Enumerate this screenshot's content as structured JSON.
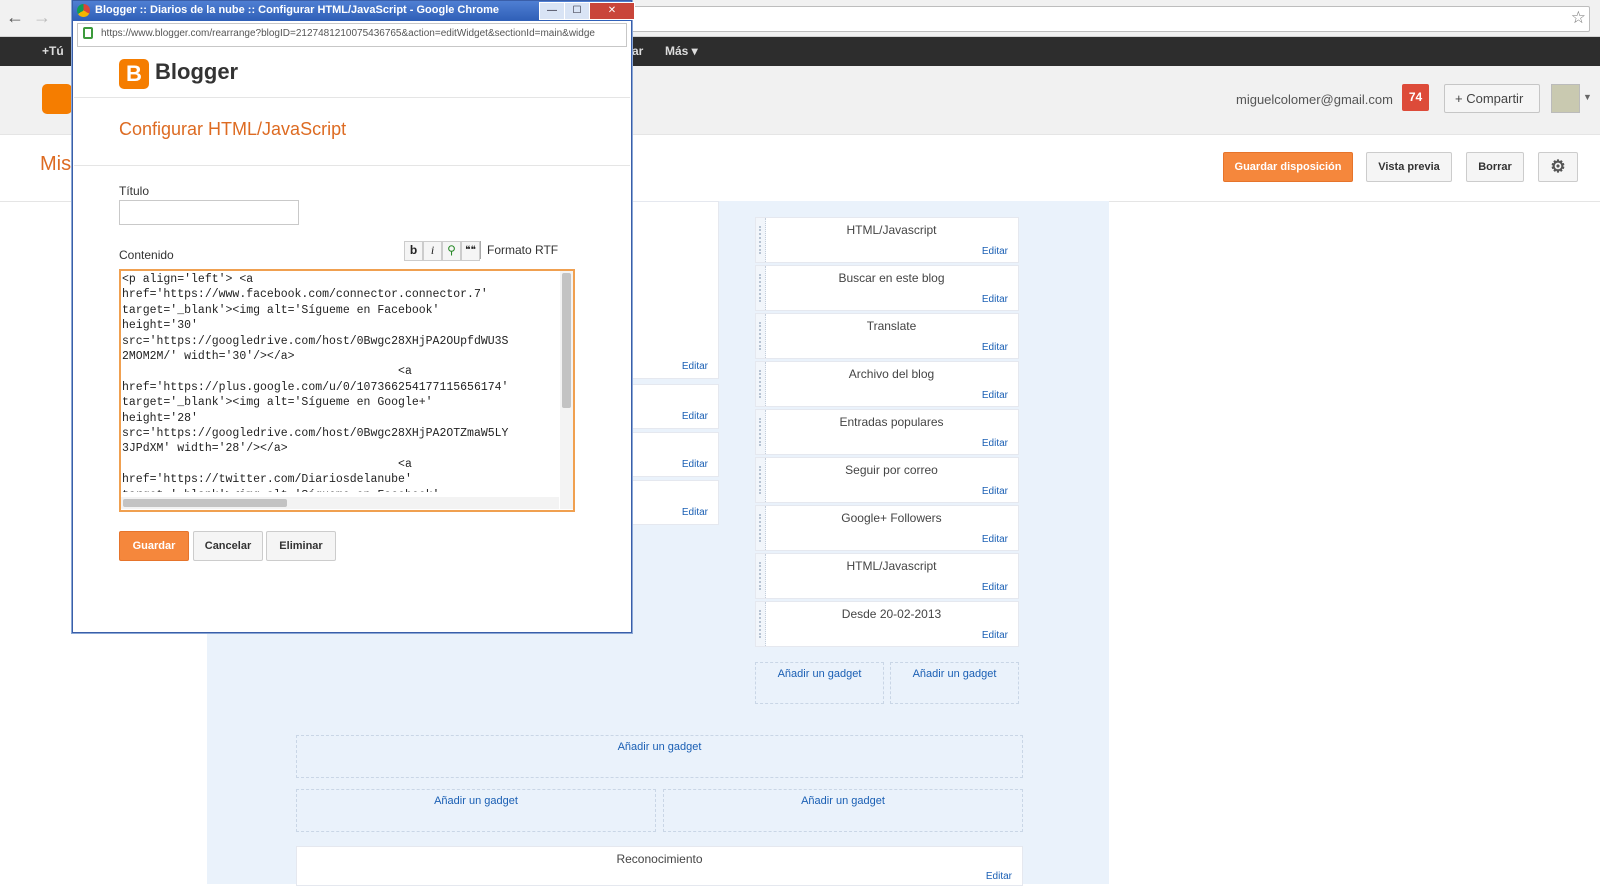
{
  "browser": {
    "popup_title": "Blogger :: Diarios de la nube :: Configurar HTML/JavaScript - Google Chrome",
    "popup_url": "https://www.blogger.com/rearrange?blogID=2127481210075436765&action=editWidget&sectionId=main&widge",
    "min": "—",
    "max": "☐",
    "close": "✕"
  },
  "gbar": {
    "tu": "+Tú",
    "ar": "ar",
    "mas": "Más ▾"
  },
  "header": {
    "email": "miguelcolomer@gmail.com",
    "notifications": "74",
    "share": "+  Compartir",
    "section_title": "Mis"
  },
  "toolbar": {
    "save_layout": "Guardar disposición",
    "preview": "Vista previa",
    "delete": "Borrar",
    "settings_icon": "⚙"
  },
  "dialog": {
    "brand": "Blogger",
    "brand_mark": "B",
    "heading": "Configurar HTML/JavaScript",
    "title_label": "Título",
    "title_value": "",
    "content_label": "Contenido",
    "fmt_bold": "b",
    "fmt_italic": "i",
    "fmt_quote": "❝❝",
    "rich_text": "Formato RTF",
    "save": "Guardar",
    "cancel": "Cancelar",
    "remove": "Eliminar",
    "code_lines": [
      "<p align='left'> <a",
      "href='https://www.facebook.com/connector.connector.7'",
      "target='_blank'><img alt='Sígueme en Facebook'",
      "height='30'",
      "src='https://googledrive.com/host/0Bwgc28XHjPA2OUpfdWU3S",
      "2MOM2M/' width='30'/></a>",
      "                                        <a",
      "href='https://plus.google.com/u/0/107366254177115656174'",
      "target='_blank'><img alt='Sígueme en Google+'",
      "height='28'",
      "src='https://googledrive.com/host/0Bwgc28XHjPA2OTZmaW5LY",
      "3JPdXM' width='28'/></a>",
      "                                        <a",
      "href='https://twitter.com/Diariosdelanube'",
      "target='_blank'><img alt='Sígueme en Facebook'"
    ]
  },
  "layout": {
    "edit_label": "Editar",
    "add_gadget": "Añadir un gadget",
    "sidebar_gadgets": [
      "HTML/Javascript",
      "Buscar en este blog",
      "Translate",
      "Archivo del blog",
      "Entradas populares",
      "Seguir por correo",
      "Google+ Followers",
      "HTML/Javascript",
      "Desde 20-02-2013"
    ],
    "footer_gadget": "Reconocimiento"
  }
}
